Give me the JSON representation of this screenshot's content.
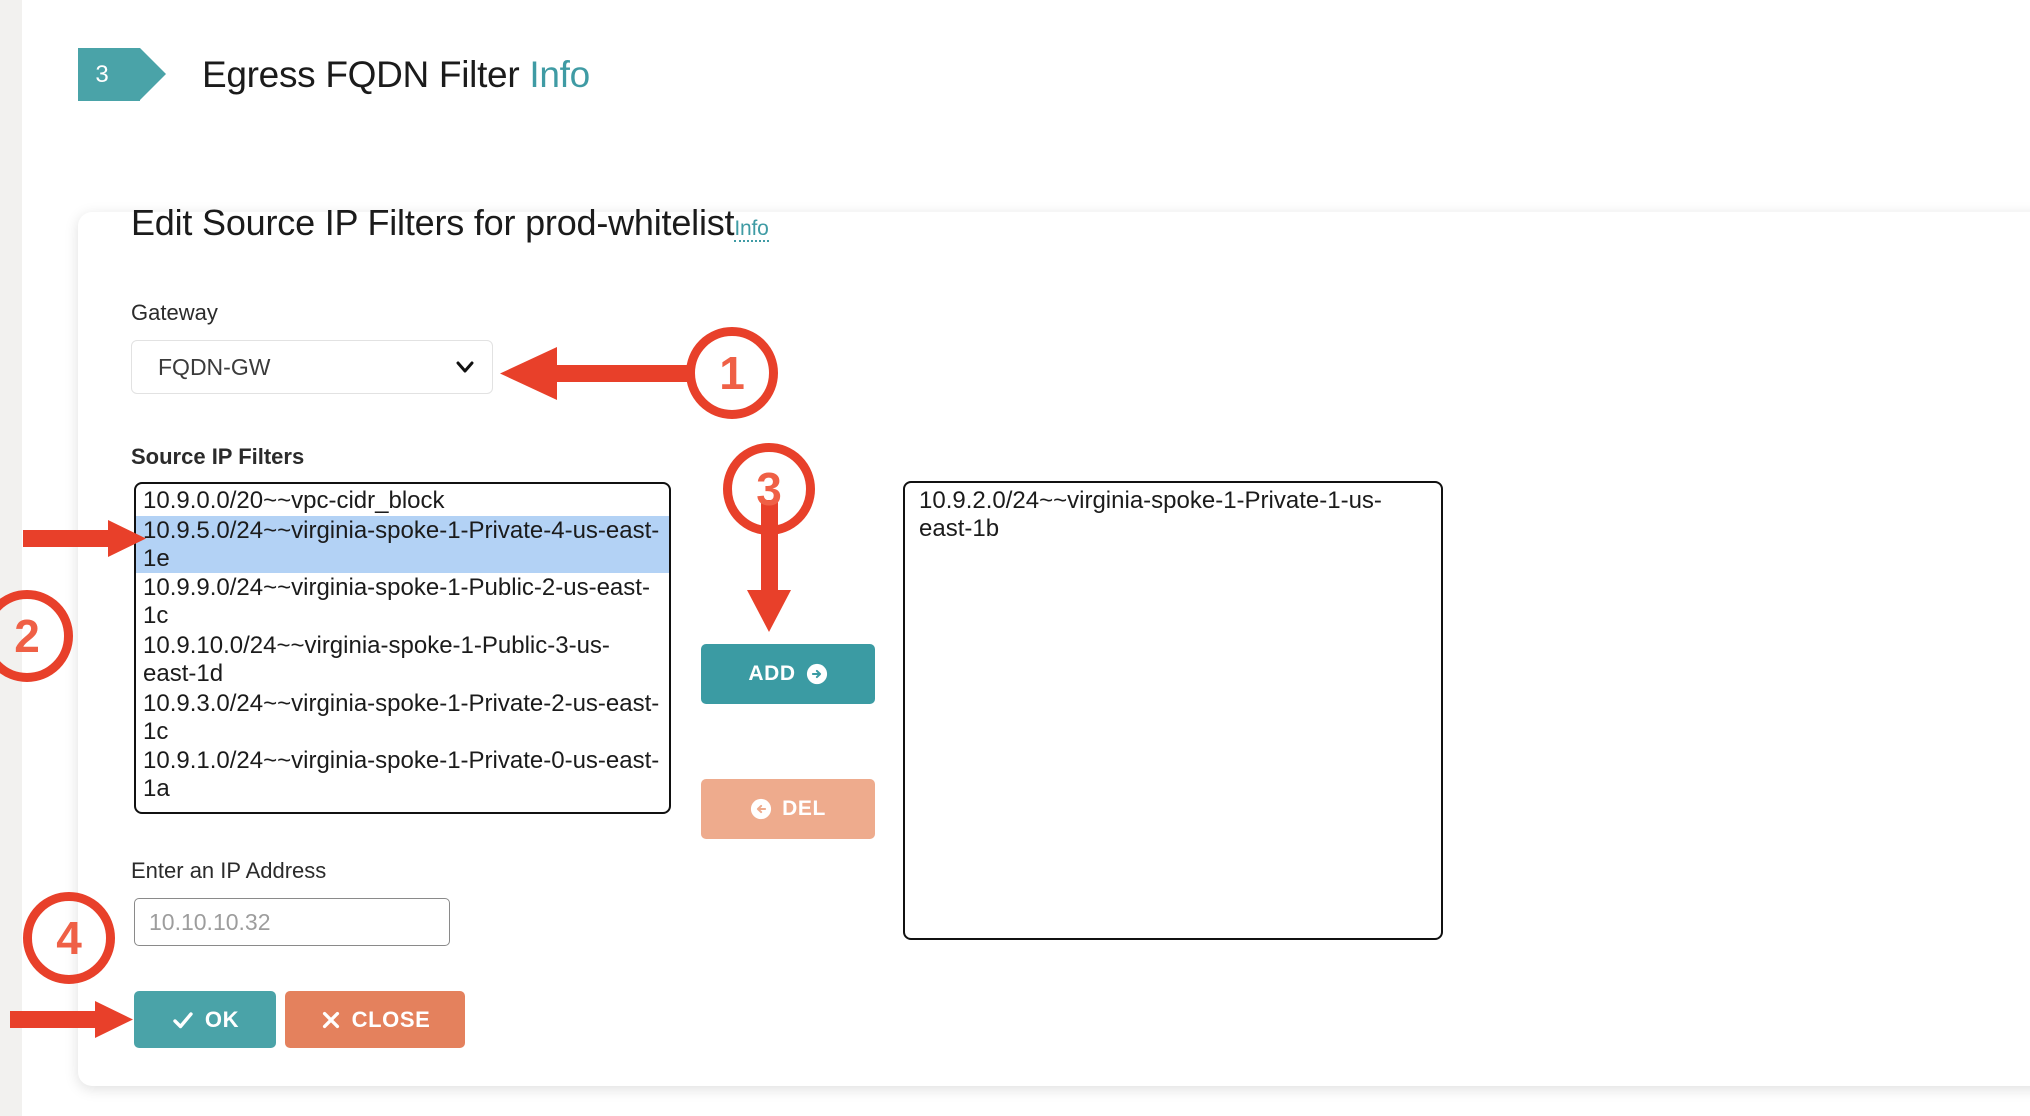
{
  "step": {
    "number": "3",
    "title": "Egress FQDN Filter",
    "info_label": "Info"
  },
  "form": {
    "heading": "Edit Source IP Filters for prod-whitelist",
    "heading_info": "Info"
  },
  "gateway": {
    "label": "Gateway",
    "selected": "FQDN-GW",
    "options": [
      "FQDN-GW"
    ],
    "caret_icon": "chevron-down-icon"
  },
  "source_filters": {
    "label": "Source IP Filters",
    "items": [
      {
        "text": "10.9.0.0/20~~vpc-cidr_block",
        "selected": false
      },
      {
        "text": "10.9.5.0/24~~virginia-spoke-1-Private-4-us-east-1e",
        "selected": true
      },
      {
        "text": "10.9.9.0/24~~virginia-spoke-1-Public-2-us-east-1c",
        "selected": false
      },
      {
        "text": "10.9.10.0/24~~virginia-spoke-1-Public-3-us-east-1d",
        "selected": false
      },
      {
        "text": "10.9.3.0/24~~virginia-spoke-1-Private-2-us-east-1c",
        "selected": false
      },
      {
        "text": "10.9.1.0/24~~virginia-spoke-1-Private-0-us-east-1a",
        "selected": false
      }
    ],
    "selected_highlight_color": "#b3d2f5"
  },
  "destination_filters": {
    "items": [
      {
        "text": "10.9.2.0/24~~virginia-spoke-1-Private-1-us-east-1b"
      }
    ]
  },
  "transfer_buttons": {
    "add_label": "ADD",
    "add_icon": "arrow-right-circle-icon",
    "add_color": "#3b9ba3",
    "del_label": "DEL",
    "del_icon": "arrow-left-circle-icon",
    "del_color": "#eeab8d"
  },
  "ip_entry": {
    "label": "Enter an IP Address",
    "value": "",
    "placeholder": "10.10.10.32"
  },
  "footer": {
    "ok_label": "OK",
    "ok_icon": "check-icon",
    "ok_color": "#4aa3a8",
    "close_label": "CLOSE",
    "close_icon": "times-icon",
    "close_color": "#e4815d"
  },
  "annotations": {
    "color": "#e8402a",
    "markers": [
      {
        "id": "1",
        "points_to": "gateway-select"
      },
      {
        "id": "2",
        "points_to": "source-filter-selected-item"
      },
      {
        "id": "3",
        "points_to": "add-button"
      },
      {
        "id": "4",
        "points_to": "ok-button"
      }
    ]
  },
  "theme": {
    "accent_teal": "#4aa3a8",
    "accent_orange": "#e4815d",
    "annotation_red": "#e8402a"
  }
}
